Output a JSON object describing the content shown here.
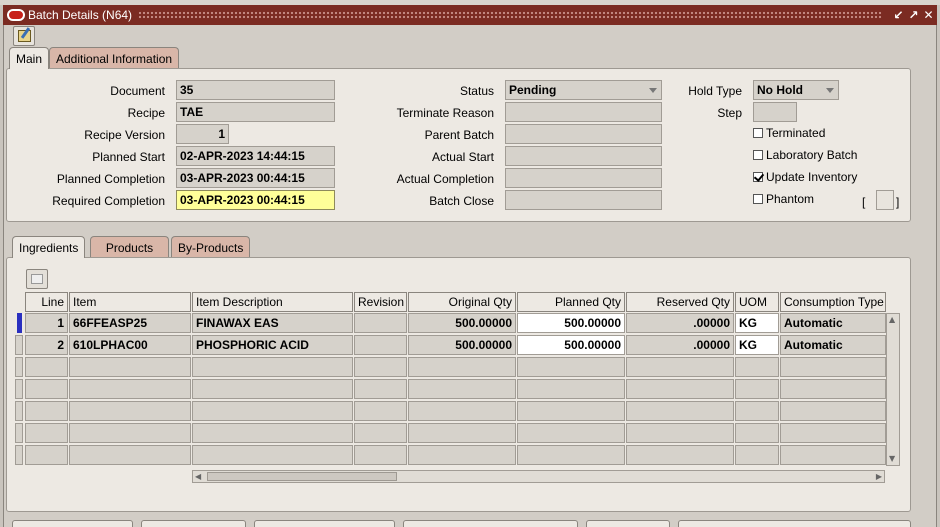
{
  "window": {
    "title": "Batch Details (N64)"
  },
  "tabs": {
    "main": "Main",
    "additional": "Additional Information"
  },
  "main": {
    "document_label": "Document",
    "document": "35",
    "recipe_label": "Recipe",
    "recipe": "TAE",
    "recipe_version_label": "Recipe Version",
    "recipe_version": "1",
    "planned_start_label": "Planned Start",
    "planned_start": "02-APR-2023 14:44:15",
    "planned_completion_label": "Planned Completion",
    "planned_completion": "03-APR-2023 00:44:15",
    "required_completion_label": "Required Completion",
    "required_completion": "03-APR-2023 00:44:15",
    "status_label": "Status",
    "status": "Pending",
    "terminate_reason_label": "Terminate Reason",
    "parent_batch_label": "Parent Batch",
    "actual_start_label": "Actual Start",
    "actual_completion_label": "Actual Completion",
    "batch_close_label": "Batch Close",
    "hold_type_label": "Hold Type",
    "hold_type": "No Hold",
    "step_label": "Step",
    "terminated_label": "Terminated",
    "terminated": false,
    "laboratory_batch_label": "Laboratory Batch",
    "laboratory_batch": false,
    "update_inventory_label": "Update Inventory",
    "update_inventory": true,
    "phantom_label": "Phantom",
    "phantom": false,
    "bracket_open": "[",
    "bracket_close": "]"
  },
  "subtabs": {
    "ingredients": "Ingredients",
    "products": "Products",
    "by_products": "By-Products"
  },
  "grid": {
    "columns": [
      "Line",
      "Item",
      "Item Description",
      "Revision",
      "Original Qty",
      "Planned Qty",
      "Reserved Qty",
      "UOM",
      "Consumption Type"
    ],
    "rows": [
      {
        "line": "1",
        "item": "66FFEASP25",
        "description": "FINAWAX  EAS",
        "revision": "",
        "original_qty": "500.00000",
        "planned_qty": "500.00000",
        "reserved_qty": ".00000",
        "uom": "KG",
        "consumption_type": "Automatic"
      },
      {
        "line": "2",
        "item": "610LPHAC00",
        "description": "PHOSPHORIC ACID",
        "revision": "",
        "original_qty": "500.00000",
        "planned_qty": "500.00000",
        "reserved_qty": ".00000",
        "uom": "KG",
        "consumption_type": "Automatic"
      }
    ]
  },
  "colors": {
    "title_bar": "#7b2b22",
    "required_field": "#ffff99",
    "inactive_tab": "#d9b6a8",
    "current_row": "#2a2fbf"
  },
  "icons": [
    "oracle-icon",
    "edit-icon",
    "attachment-icon"
  ]
}
